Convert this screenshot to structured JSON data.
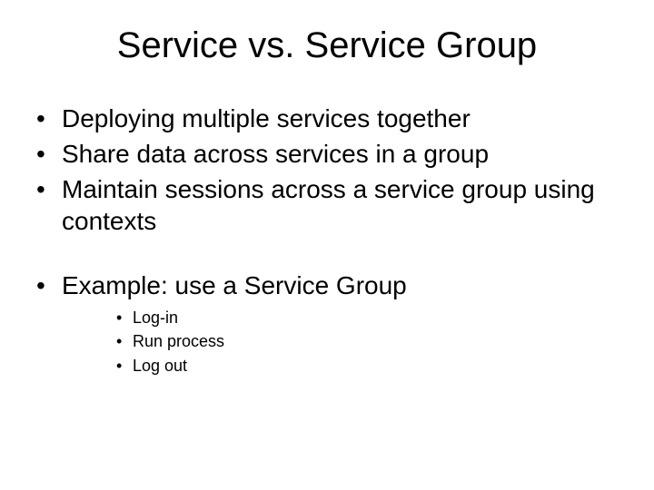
{
  "title": "Service vs. Service Group",
  "bullets": {
    "b1": "Deploying multiple services together",
    "b2": "Share data across services in a group",
    "b3": "Maintain sessions across a service group using contexts",
    "b4": "Example: use a Service Group",
    "sub": {
      "s1": "Log-in",
      "s2": "Run process",
      "s3": "Log out"
    }
  }
}
